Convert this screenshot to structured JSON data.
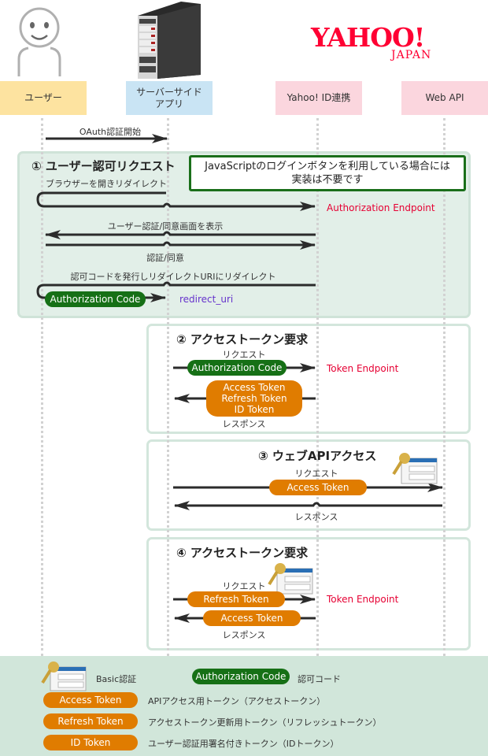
{
  "actors": {
    "user": {
      "label": "ユーザー",
      "color": "#fde3a0"
    },
    "server": {
      "label": "サーバーサイド\nアプリ",
      "color": "#c9e4f4"
    },
    "yahoo_id": {
      "label": "Yahoo! ID連携",
      "color": "#fbd6de"
    },
    "web_api": {
      "label": "Web API",
      "color": "#fbd6de"
    }
  },
  "logo": {
    "main": "YAHOO!",
    "sub": "JAPAN",
    "color": "#ff0033"
  },
  "intro": {
    "label": "OAuth認証開始"
  },
  "step1": {
    "title": "① ユーザー認可リクエスト",
    "note": "JavaScriptのログインボタンを利用している場合には\n実装は不要です",
    "redirect_label": "ブラウザーを開きリダイレクト",
    "endpoint": "Authorization Endpoint",
    "show_consent": "ユーザー認証/同意画面を表示",
    "consent": "認証/同意",
    "issue_code": "認可コードを発行しリダイレクトURIにリダイレクト",
    "code_pill": "Authorization Code",
    "redirect_uri": "redirect_uri"
  },
  "step2": {
    "title": "② アクセストークン要求",
    "request": "リクエスト",
    "code_pill": "Authorization Code",
    "endpoint": "Token Endpoint",
    "tokens": [
      "Access Token",
      "Refresh Token",
      "ID Token"
    ],
    "response": "レスポンス"
  },
  "step3": {
    "title": "③ ウェブAPIアクセス",
    "request": "リクエスト",
    "token_pill": "Access Token",
    "response": "レスポンス"
  },
  "step4": {
    "title": "④ アクセストークン要求",
    "request": "リクエスト",
    "refresh_pill": "Refresh Token",
    "endpoint": "Token Endpoint",
    "access_pill": "Access Token",
    "response": "レスポンス"
  },
  "legend": {
    "basic_auth": "Basic認証",
    "auth_code_pill": "Authorization Code",
    "auth_code_desc": "認可コード",
    "items": [
      {
        "pill": "Access Token",
        "desc": "APIアクセス用トークン（アクセストークン）"
      },
      {
        "pill": "Refresh Token",
        "desc": "アクセストークン更新用トークン（リフレッシュトークン）"
      },
      {
        "pill": "ID Token",
        "desc": "ユーザー認証用署名付きトークン（IDトークン）"
      }
    ]
  },
  "colors": {
    "green_pill": "#167016",
    "orange_pill": "#e07c00",
    "endpoint_red": "#e60033",
    "redirect_purple": "#6633cc"
  }
}
